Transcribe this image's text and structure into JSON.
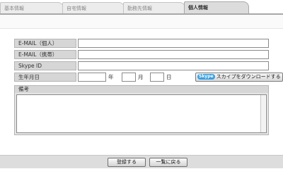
{
  "tabs": [
    {
      "label": "基本情報",
      "active": false
    },
    {
      "label": "自宅情報",
      "active": false
    },
    {
      "label": "勤務先情報",
      "active": false
    },
    {
      "label": "個人情報",
      "active": true
    }
  ],
  "form": {
    "email_personal": {
      "label": "E-MAIL（個人）",
      "value": ""
    },
    "email_mobile": {
      "label": "E-MAIL（携帯）",
      "value": ""
    },
    "skype_id": {
      "label": "Skype ID",
      "value": ""
    },
    "birthdate": {
      "label": "生年月日",
      "year_unit": "年",
      "month_unit": "月",
      "day_unit": "日",
      "year": "",
      "month": "",
      "day": ""
    },
    "skype_download": {
      "logo": "Skype",
      "label": "スカイプをダウンロードする"
    },
    "notes": {
      "label": "備考",
      "value": ""
    }
  },
  "footer": {
    "save_label": "登録する",
    "back_label": "一覧に戻る"
  }
}
